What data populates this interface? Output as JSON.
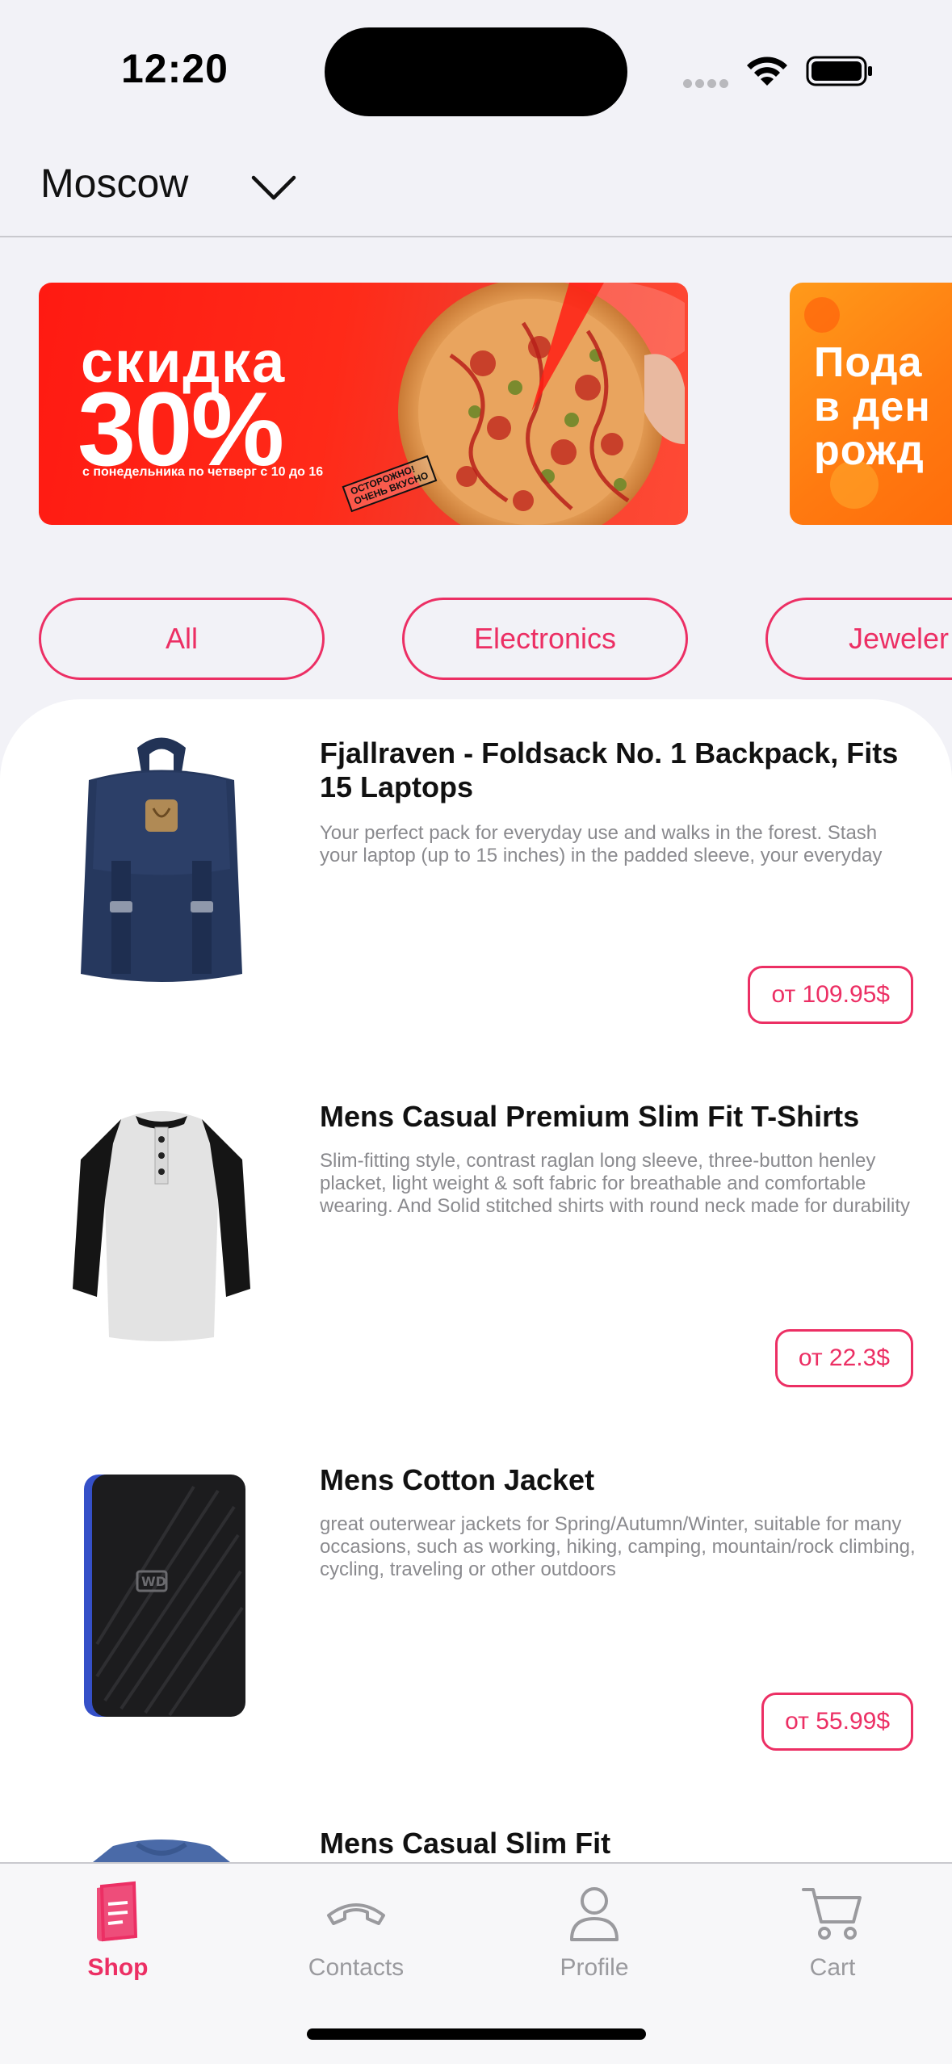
{
  "status_bar": {
    "time": "12:20",
    "icons": [
      "cellular-dots-icon",
      "wifi-icon",
      "battery-icon"
    ]
  },
  "location": {
    "city": "Moscow",
    "icon": "chevron-down-icon"
  },
  "banners": [
    {
      "title": "скидка",
      "big": "30%",
      "subtitle": "с понедельника по четверг с 10 до 16",
      "stamp_line1": "ОСТОРОЖНО!",
      "stamp_line2": "ОЧЕНЬ ВКУСНО",
      "color": "#ff1f14"
    },
    {
      "line1": "Пода",
      "line2": "в ден",
      "line3": "рожд",
      "color": "#ff8a12"
    }
  ],
  "categories": [
    "All",
    "Electronics",
    "Jeweler"
  ],
  "products": [
    {
      "title": "Fjallraven - Foldsack No. 1 Backpack, Fits 15 Laptops",
      "description": "Your perfect pack for everyday use and walks in the forest. Stash your laptop (up to 15 inches) in the padded sleeve, your everyday",
      "price": "от 109.95$",
      "image": "backpack-image"
    },
    {
      "title": "Mens Casual Premium Slim Fit T-Shirts",
      "description": "Slim-fitting style, contrast raglan long sleeve, three-button henley placket, light weight & soft fabric for breathable and comfortable wearing. And Solid stitched shirts with round neck made for durability",
      "price": "от 22.3$",
      "image": "tshirt-image"
    },
    {
      "title": "Mens Cotton Jacket",
      "description": "great outerwear jackets for Spring/Autumn/Winter, suitable for many occasions, such as working, hiking, camping, mountain/rock climbing, cycling, traveling or other outdoors",
      "price": "от 55.99$",
      "image": "hard-drive-image"
    },
    {
      "title": "Mens Casual Slim Fit",
      "description": "",
      "price": "",
      "image": "shirt-image"
    }
  ],
  "tabs": [
    {
      "label": "Shop",
      "icon": "shop-icon",
      "active": true
    },
    {
      "label": "Contacts",
      "icon": "phone-icon",
      "active": false
    },
    {
      "label": "Profile",
      "icon": "profile-icon",
      "active": false
    },
    {
      "label": "Cart",
      "icon": "cart-icon",
      "active": false
    }
  ],
  "colors": {
    "accent": "#ec2f64",
    "background": "#f2f2f7",
    "inactive_tab": "#9a9a9e"
  }
}
